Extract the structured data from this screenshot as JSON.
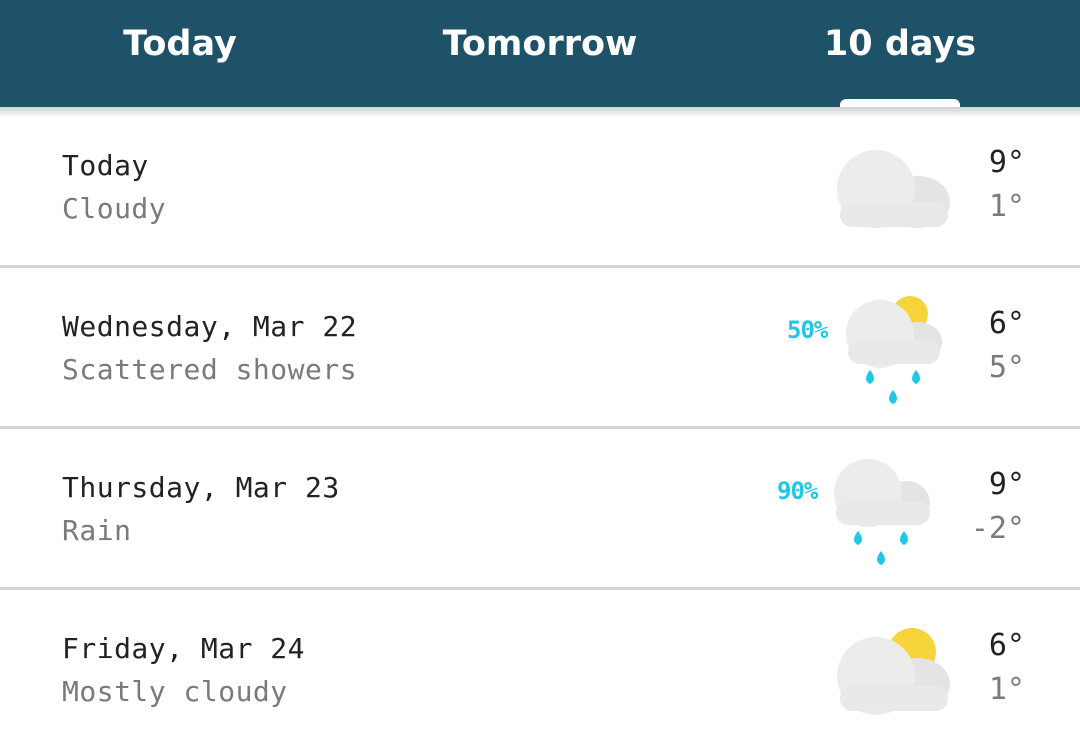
{
  "tabs": [
    {
      "label": "Today"
    },
    {
      "label": "Tomorrow"
    },
    {
      "label": "10 days"
    }
  ],
  "selected_tab": "10 days",
  "days": [
    {
      "day": "Today",
      "condition": "Cloudy",
      "precip": "",
      "high": "9°",
      "low": "1°",
      "icon": "cloudy-icon"
    },
    {
      "day": "Wednesday, Mar 22",
      "condition": "Scattered showers",
      "precip": "50%",
      "high": "6°",
      "low": "5°",
      "icon": "scattered-showers-icon"
    },
    {
      "day": "Thursday, Mar 23",
      "condition": "Rain",
      "precip": "90%",
      "high": "9°",
      "low": "-2°",
      "icon": "rain-icon"
    },
    {
      "day": "Friday, Mar 24",
      "condition": "Mostly cloudy",
      "precip": "",
      "high": "6°",
      "low": "1°",
      "icon": "mostly-cloudy-icon"
    }
  ],
  "colors": {
    "header": "#1d5269",
    "precip": "#1fc8e6",
    "sun": "#f7d43a",
    "cloud": "#e8e8e8"
  }
}
